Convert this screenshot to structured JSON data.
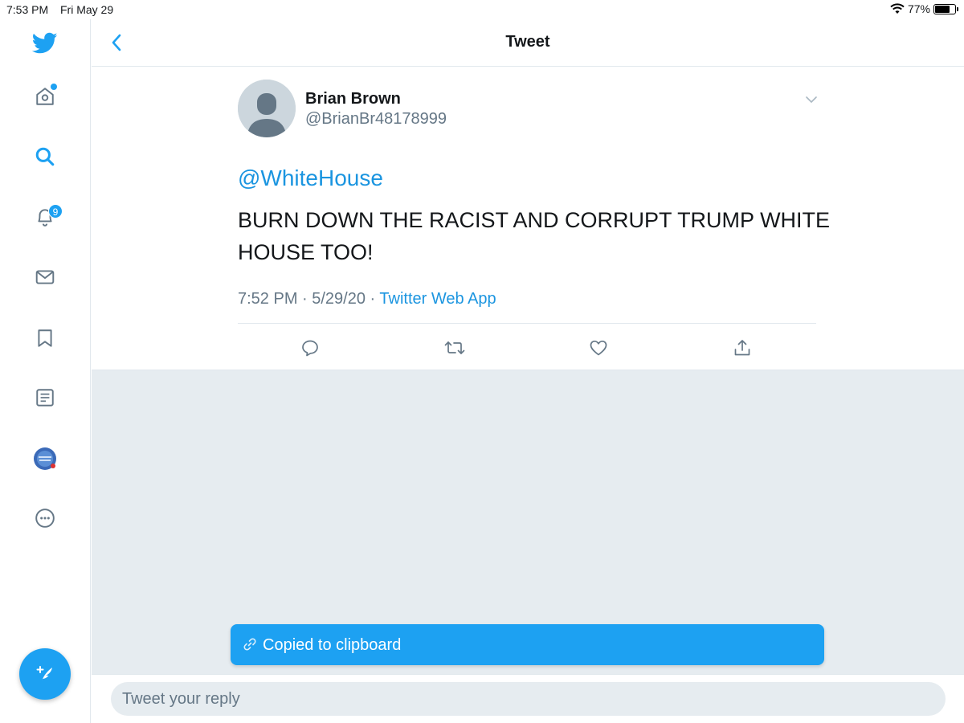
{
  "status_bar": {
    "time": "7:53 PM",
    "date": "Fri May 29",
    "battery_percent": "77%",
    "battery_level": 0.77
  },
  "sidebar": {
    "notifications_badge": "9",
    "items": [
      {
        "name": "twitter-logo-icon"
      },
      {
        "name": "home-icon"
      },
      {
        "name": "search-icon"
      },
      {
        "name": "notifications-icon"
      },
      {
        "name": "messages-icon"
      },
      {
        "name": "bookmarks-icon"
      },
      {
        "name": "lists-icon"
      },
      {
        "name": "profile-avatar"
      },
      {
        "name": "more-icon"
      }
    ]
  },
  "header": {
    "title": "Tweet"
  },
  "tweet": {
    "display_name": "Brian Brown",
    "handle": "@BrianBr48178999",
    "mention": "@WhiteHouse",
    "text": "BURN DOWN THE RACIST AND CORRUPT TRUMP WHITE HOUSE TOO!",
    "timestamp": "7:52 PM · 5/29/20 · ",
    "source": "Twitter Web App"
  },
  "toast": {
    "text": "Copied to clipboard"
  },
  "reply": {
    "placeholder": "Tweet your reply"
  },
  "colors": {
    "accent": "#1da1f2",
    "link": "#1b95e0",
    "secondary_text": "#657786",
    "background_grey": "#e6ecf0"
  }
}
